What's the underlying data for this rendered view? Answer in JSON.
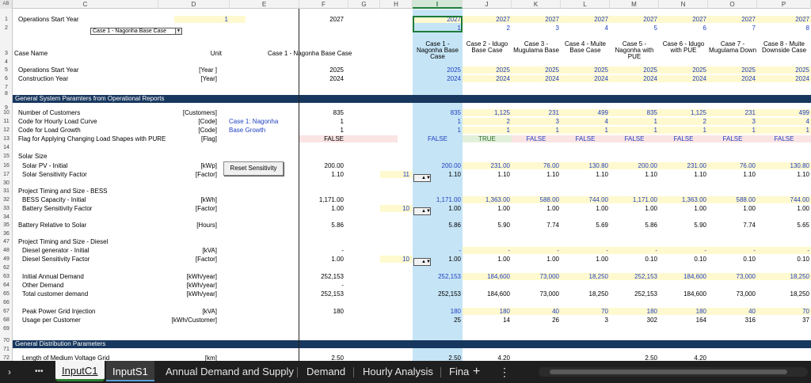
{
  "sheet": {
    "columns": [
      "C",
      "D",
      "E",
      "F",
      "G",
      "H",
      "I",
      "J",
      "K",
      "L",
      "M",
      "N",
      "O",
      "P"
    ],
    "selected_column": "I",
    "rows": [
      "1",
      "2",
      "3",
      "4",
      "5",
      "6",
      "7",
      "8",
      "9",
      "10",
      "11",
      "12",
      "13",
      "14",
      "15",
      "16",
      "17",
      "30",
      "31",
      "32",
      "33",
      "34",
      "35",
      "36",
      "47",
      "48",
      "49",
      "62",
      "63",
      "64",
      "65",
      "66",
      "67",
      "68",
      "69",
      "70",
      "71",
      "72"
    ],
    "r1_label": "Operations Start Year",
    "r1_d": "1",
    "r1_f": "2027",
    "r1_cases": [
      "2027",
      "2027",
      "2027",
      "2027",
      "2027",
      "2027",
      "2027",
      "2027"
    ],
    "r2_indices": [
      "1",
      "2",
      "3",
      "4",
      "5",
      "6",
      "7",
      "8"
    ],
    "dropdown_value": "Case 1 - Nagonha Base Case",
    "r3": {
      "name": "Case Name",
      "unit": "Unit",
      "f": "Case 1 - Nagonha Base Case"
    },
    "case_headers": [
      "Case 1 - Nagonha Base Case",
      "Case 2 - Idugo Base Case",
      "Case 3 - Mugulama Base",
      "Case 4 - Muite Base Case",
      "Case 5 - Nagonha with PUE",
      "Case 6 - Idugo with PUE",
      "Case 7 - Mugulama Down",
      "Case 8 - Muite Downside Case"
    ],
    "bands": {
      "ops": "General System Paramters from Operational Reports",
      "dist": "General Distribution Parameters"
    },
    "reset_button": "Reset Sensitivity",
    "lines": [
      {
        "id": "r5",
        "label": "Operations Start Year",
        "unit": "[Year ]",
        "f": "2025",
        "vals": [
          "2025",
          "2025",
          "2025",
          "2025",
          "2025",
          "2025",
          "2025",
          "2025"
        ]
      },
      {
        "id": "r6",
        "label": "Construction Year",
        "unit": "[Year]",
        "f": "2024",
        "vals": [
          "2024",
          "2024",
          "2024",
          "2024",
          "2024",
          "2024",
          "2024",
          "2024"
        ]
      },
      {
        "id": "r10",
        "label": "Number of Customers",
        "unit": "[Customers]",
        "f": "835",
        "vals": [
          "835",
          "1,125",
          "231",
          "499",
          "835",
          "1,125",
          "231",
          "499"
        ]
      },
      {
        "id": "r11",
        "label": "Code for Hourly Load Curve",
        "unit": "[Code]",
        "note": "Case 1: Nagonha",
        "f": "1",
        "vals": [
          "1",
          "2",
          "3",
          "4",
          "1",
          "2",
          "3",
          "4"
        ]
      },
      {
        "id": "r12",
        "label": "Code for Load Growth",
        "unit": "[Code]",
        "note": "Base Growth",
        "f": "1",
        "vals": [
          "1",
          "1",
          "1",
          "1",
          "1",
          "1",
          "1",
          "1"
        ]
      },
      {
        "id": "r13",
        "label": "Flag for Applying Changing Load Shapes with PURE",
        "unit": "[Flag]",
        "f": "FALSE",
        "vals": [
          "FALSE",
          "TRUE",
          "FALSE",
          "FALSE",
          "FALSE",
          "FALSE",
          "FALSE",
          "FALSE"
        ]
      },
      {
        "id": "r15",
        "label": "Solar Size"
      },
      {
        "id": "r16",
        "label": "Solar PV - Initial",
        "unit": "[kWp]",
        "f": "200.00",
        "vals": [
          "200.00",
          "231.00",
          "76.00",
          "130.80",
          "200.00",
          "231.00",
          "76.00",
          "130.80"
        ]
      },
      {
        "id": "r17",
        "label": "Solar Sensitivity Factor",
        "unit": "[Factor]",
        "f": "1.10",
        "h": "11",
        "vals": [
          "1.10",
          "1.10",
          "1.10",
          "1.10",
          "1.10",
          "1.10",
          "1.10",
          "1.10"
        ]
      },
      {
        "id": "r31",
        "label": "Project Timing and Size - BESS"
      },
      {
        "id": "r32",
        "label": "BESS Capacity - Initial",
        "unit": "[kWh]",
        "f": "1,171.00",
        "vals": [
          "1,171.00",
          "1,363.00",
          "588.00",
          "744.00",
          "1,171.00",
          "1,363.00",
          "588.00",
          "744.00"
        ]
      },
      {
        "id": "r33",
        "label": "Battery Sensitivity Factor",
        "unit": "[Factor]",
        "f": "1.00",
        "h": "10",
        "vals": [
          "1.00",
          "1.00",
          "1.00",
          "1.00",
          "1.00",
          "1.00",
          "1.00",
          "1.00"
        ]
      },
      {
        "id": "r35",
        "label": "Battery Relative to Solar",
        "unit": "[Hours]",
        "f": "5.86",
        "vals": [
          "5.86",
          "5.90",
          "7.74",
          "5.69",
          "5.86",
          "5.90",
          "7.74",
          "5.65"
        ]
      },
      {
        "id": "r47",
        "label": "Project Timing and Size - Diesel"
      },
      {
        "id": "r48",
        "label": "Diesel generator - Initial",
        "unit": "[kVA]",
        "f": "-",
        "vals": [
          "-",
          "-",
          "-",
          "-",
          "-",
          "-",
          "-",
          "-"
        ]
      },
      {
        "id": "r49",
        "label": "Diesel Sensitivity Factor",
        "unit": "[Factor]",
        "f": "1.00",
        "h": "10",
        "vals": [
          "1.00",
          "1.00",
          "1.00",
          "1.00",
          "0.10",
          "0.10",
          "0.10",
          "0.10"
        ]
      },
      {
        "id": "r63",
        "label": "Initial Annual Demand",
        "unit": "[kWh/year]",
        "f": "252,153",
        "vals": [
          "252,153",
          "184,600",
          "73,000",
          "18,250",
          "252,153",
          "184,600",
          "73,000",
          "18,250"
        ]
      },
      {
        "id": "r64",
        "label": "Other Demand",
        "unit": "[kWh/year]",
        "f": "-",
        "vals": [
          "",
          "",
          "",
          "",
          "",
          "",
          "",
          ""
        ]
      },
      {
        "id": "r65",
        "label": "Total customer demand",
        "unit": "[kWh/year]",
        "f": "252,153",
        "vals": [
          "252,153",
          "184,600",
          "73,000",
          "18,250",
          "252,153",
          "184,600",
          "73,000",
          "18,250"
        ]
      },
      {
        "id": "r67",
        "label": "Peak Power Grid Injection",
        "unit": "[kVA]",
        "f": "180",
        "vals": [
          "180",
          "180",
          "40",
          "70",
          "180",
          "180",
          "40",
          "70"
        ]
      },
      {
        "id": "r68",
        "label": "Usage per Customer",
        "unit": "[kWh/Customer]",
        "f": "",
        "vals": [
          "25",
          "14",
          "26",
          "3",
          "302",
          "164",
          "316",
          "37"
        ]
      },
      {
        "id": "r72",
        "label": "Length of Medium Voltage Grid",
        "unit": "[km]",
        "f": "2.50",
        "vals": [
          "2.50",
          "4.20",
          "",
          "",
          "2.50",
          "4.20",
          "",
          ""
        ]
      }
    ]
  },
  "tabs": {
    "more": "•••",
    "items": [
      "InputC1",
      "InputS1",
      "Annual Demand and Supply",
      "Demand",
      "Hourly Analysis",
      "Fina"
    ],
    "add": "+",
    "menu": "⋮"
  },
  "colors": {
    "band": "#17375e",
    "blue": "#1f3fbf",
    "selected_col": "#c5e4f6",
    "input_yellow": "#fff9cf",
    "false_pink": "#fbe4e4",
    "true_green": "#e2f0d9",
    "tab_active_underline": "#2e7d32"
  }
}
